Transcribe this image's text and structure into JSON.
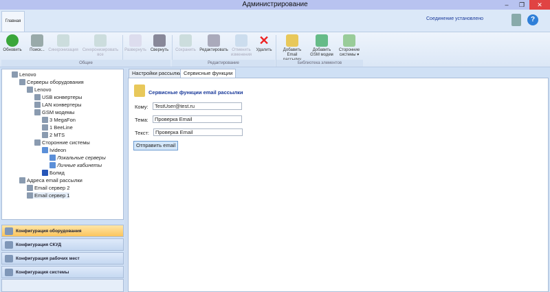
{
  "window": {
    "title": "Администрирование",
    "min": "–",
    "max": "❐",
    "close": "✕"
  },
  "ribbon": {
    "tab": "Главная",
    "status": "Соединение установлено",
    "buttons": [
      "Обновить",
      "Поиск...",
      "Синхронизация",
      "Синхронизировать все",
      "Развернуть",
      "Свернуть",
      "Сохранить",
      "Редактировать",
      "Отменить изменения",
      "Удалить",
      "Добавить Email рассылку",
      "Добавить GSM модем",
      "Сторонние системы ▾"
    ],
    "groups": [
      "Общие",
      "Редактирование",
      "Библиотека элементов"
    ]
  },
  "tree": [
    "Lenovo",
    "Серверы оборудования",
    "Lenovo",
    "USB конвертеры",
    "LAN конвертеры",
    "GSM модемы",
    "3 MegaFon",
    "1 BeeLine",
    "2 MTS",
    "Сторонние системы",
    "Ivideon",
    "Локальные серверы",
    "Личные кабинеты",
    "Болид",
    "Адреса email рассылки",
    "Email сервер 2",
    "Email сервер 1"
  ],
  "accordion": [
    "Конфигурация оборудования",
    "Конфигурация СКУД",
    "Конфигурация рабочих мест",
    "Конфигурация системы"
  ],
  "tabs": [
    "Настройки рассылки",
    "Сервисные функции"
  ],
  "form": {
    "heading": "Сервисные функции email рассылки",
    "to_label": "Кому:",
    "to": "TestUser@test.ru",
    "subject_label": "Тема:",
    "subject": "Проверка Email",
    "text_label": "Текст:",
    "text": "Проверка Email",
    "send": "Отправить email"
  }
}
